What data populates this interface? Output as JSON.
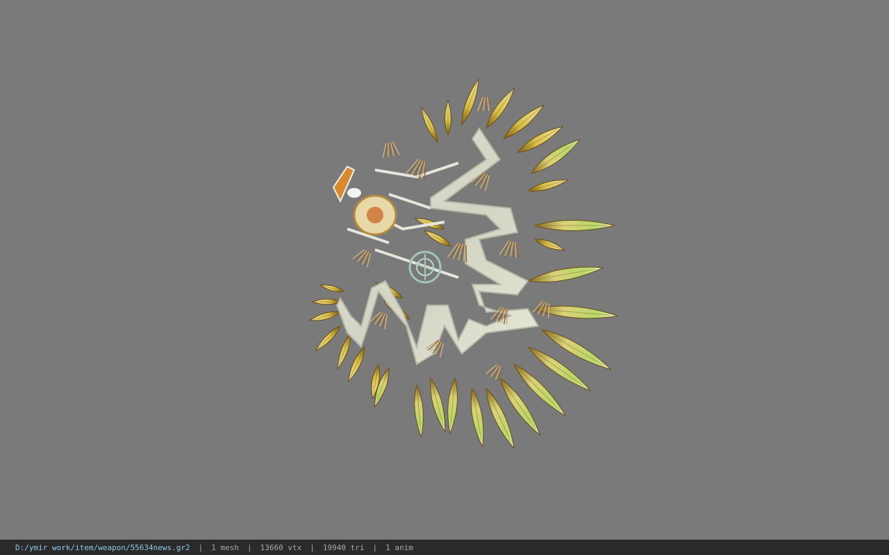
{
  "viewport": {
    "background_color": "#7a7a7a",
    "model_name": "feathered-wing-weapon-model"
  },
  "statusbar": {
    "file_path": "D:/ymir work/item/weapon/55634news.gr2",
    "separator": "|",
    "mesh_count": "1 mesh",
    "vertex_count": "13660 vtx",
    "triangle_count": "19940 tri",
    "anim_count": "1 anim",
    "path_color": "#8fc7e8",
    "text_color": "#a8a8a8",
    "background_color": "#2a2a2a"
  }
}
